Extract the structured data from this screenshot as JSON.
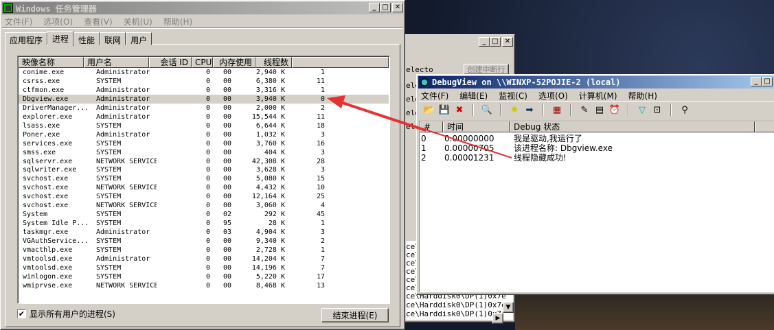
{
  "task_manager": {
    "title": "Windows 任务管理器",
    "menu": [
      "文件(F)",
      "选项(O)",
      "查看(V)",
      "关机(U)",
      "帮助(H)"
    ],
    "tabs": [
      "应用程序",
      "进程",
      "性能",
      "联网",
      "用户"
    ],
    "selected_tab": "进程",
    "columns": [
      "映像名称",
      "用户名",
      "会话 ID",
      "CPU",
      "内存使用",
      "线程数"
    ],
    "rows": [
      [
        "conime.exe",
        "Administrator",
        "0",
        "00",
        "2,940 K",
        "1"
      ],
      [
        "csrss.exe",
        "SYSTEM",
        "0",
        "00",
        "6,380 K",
        "11"
      ],
      [
        "ctfmon.exe",
        "Administrator",
        "0",
        "00",
        "3,316 K",
        "1"
      ],
      [
        "Dbgview.exe",
        "Administrator",
        "0",
        "00",
        "3,940 K",
        "0"
      ],
      [
        "DriverManager...",
        "Administrator",
        "0",
        "00",
        "2,000 K",
        "2"
      ],
      [
        "explorer.exe",
        "Administrator",
        "0",
        "00",
        "15,544 K",
        "11"
      ],
      [
        "lsass.exe",
        "SYSTEM",
        "0",
        "00",
        "6,644 K",
        "18"
      ],
      [
        "Poner.exe",
        "Administrator",
        "0",
        "00",
        "1,032 K",
        "3"
      ],
      [
        "services.exe",
        "SYSTEM",
        "0",
        "00",
        "3,760 K",
        "16"
      ],
      [
        "smss.exe",
        "SYSTEM",
        "0",
        "00",
        "404 K",
        "3"
      ],
      [
        "sqlservr.exe",
        "NETWORK SERVICE",
        "0",
        "00",
        "42,308 K",
        "28"
      ],
      [
        "sqlwriter.exe",
        "SYSTEM",
        "0",
        "00",
        "3,628 K",
        "3"
      ],
      [
        "svchost.exe",
        "SYSTEM",
        "0",
        "00",
        "5,080 K",
        "15"
      ],
      [
        "svchost.exe",
        "NETWORK SERVICE",
        "0",
        "00",
        "4,432 K",
        "10"
      ],
      [
        "svchost.exe",
        "SYSTEM",
        "0",
        "00",
        "12,164 K",
        "25"
      ],
      [
        "svchost.exe",
        "NETWORK SERVICE",
        "0",
        "00",
        "3,060 K",
        "4"
      ],
      [
        "System",
        "SYSTEM",
        "0",
        "02",
        "292 K",
        "45"
      ],
      [
        "System Idle P...",
        "SYSTEM",
        "0",
        "95",
        "28 K",
        "1"
      ],
      [
        "taskmgr.exe",
        "Administrator",
        "0",
        "03",
        "4,904 K",
        "3"
      ],
      [
        "VGAuthService...",
        "SYSTEM",
        "0",
        "00",
        "9,340 K",
        "2"
      ],
      [
        "vmacthlp.exe",
        "SYSTEM",
        "0",
        "00",
        "2,728 K",
        "1"
      ],
      [
        "vmtoolsd.exe",
        "Administrator",
        "0",
        "00",
        "14,204 K",
        "7"
      ],
      [
        "vmtoolsd.exe",
        "SYSTEM",
        "0",
        "00",
        "14,196 K",
        "7"
      ],
      [
        "winlogon.exe",
        "SYSTEM",
        "0",
        "00",
        "5,220 K",
        "17"
      ],
      [
        "wmiprvse.exe",
        "NETWORK SERVICE",
        "0",
        "00",
        "8,468 K",
        "13"
      ]
    ],
    "selected_row": 3,
    "show_all_label": "显示所有用户的进程(S)",
    "show_all_checked": true,
    "end_process_label": "结束进程(E)"
  },
  "bg_window": {
    "fragments": [
      "electo",
      "创建中断行",
      "ele",
      "ele",
      "ele",
      "ele",
      "ce\\",
      "ce\\",
      "ce\\",
      "ce\\",
      "ce\\",
      "ce\\",
      "ce\\Harddisk0\\DP(1)0x7e",
      "ce\\Harddisk0\\DP(1)0x7e",
      "ce\\Harddisk0\\DP(1)0x7"
    ]
  },
  "debugview": {
    "title": "DebugView on \\\\WINXP-52POJIE-2 (local)",
    "menu": [
      "文件(F)",
      "编辑(E)",
      "监视(C)",
      "选项(O)",
      "计算机(M)",
      "帮助(H)"
    ],
    "toolbar": [
      "open-icon",
      "save-icon",
      "clear-icon",
      "capture-icon",
      "capture-kernel-icon",
      "passthrough-icon",
      "history-icon",
      "autoscroll-icon",
      "timestamp-icon",
      "clock-icon",
      "filter-icon",
      "highlight-icon",
      "find-icon"
    ],
    "columns": [
      "#",
      "时间",
      "Debug 状态"
    ],
    "rows": [
      [
        "0",
        "0.00000000",
        "我是驱动,我运行了"
      ],
      [
        "1",
        "0.00000705",
        "该进程名称: Dbgview.exe"
      ],
      [
        "2",
        "0.00001231",
        "线程隐藏成功!"
      ]
    ]
  },
  "annotation_color": "#e83030"
}
